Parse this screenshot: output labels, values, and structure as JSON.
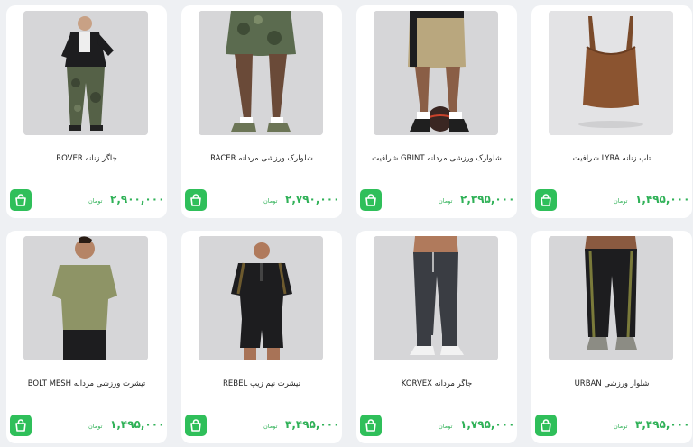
{
  "products": [
    {
      "title": "جاگر زنانه ROVER",
      "price": "۲,۹۰۰,۰۰۰",
      "unit": "تومان",
      "image": "woman-black-jacket-camo-pants"
    },
    {
      "title": "شلوارک ورزشی مردانه RACER",
      "price": "۲,۷۹۰,۰۰۰",
      "unit": "تومان",
      "image": "camo-shorts-legs"
    },
    {
      "title": "شلوارک ورزشی مردانه GRINT شرافیت",
      "price": "۲,۳۹۵,۰۰۰",
      "unit": "تومان",
      "image": "khaki-shorts-basketball"
    },
    {
      "title": "تاپ زنانه LYRA شرافیت",
      "price": "۱,۴۹۵,۰۰۰",
      "unit": "تومان",
      "image": "brown-tank-top"
    },
    {
      "title": "تیشرت ورزشی مردانه BOLT MESH",
      "price": "۱,۴۹۵,۰۰۰",
      "unit": "تومان",
      "image": "man-olive-tshirt"
    },
    {
      "title": "تیشرت نیم زیپ REBEL",
      "price": "۳,۴۹۵,۰۰۰",
      "unit": "تومان",
      "image": "man-black-halfzip"
    },
    {
      "title": "جاگر مردانه KORVEX",
      "price": "۱,۷۹۵,۰۰۰",
      "unit": "تومان",
      "image": "grey-joggers-legs"
    },
    {
      "title": "شلوار ورزشی URBAN",
      "price": "۳,۴۹۵,۰۰۰",
      "unit": "تومان",
      "image": "black-pants-olive-stripe"
    }
  ],
  "colors": {
    "accent": "#2fb157",
    "cart_bg": "#2fbf5a",
    "page_bg": "#eef0f3"
  },
  "icons": {
    "cart": "shopping-bag-icon"
  }
}
